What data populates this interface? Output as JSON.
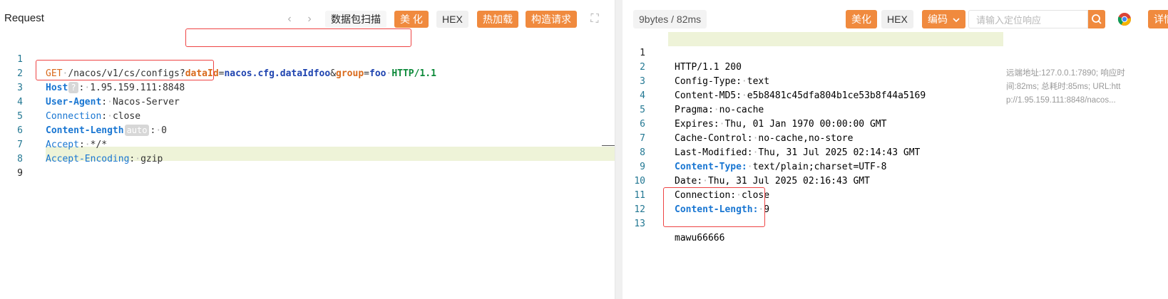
{
  "request": {
    "title": "Request",
    "toolbar": {
      "packet_scan": "数据包扫描",
      "beautify": "美 化",
      "hex": "HEX",
      "hot_load": "热加载",
      "build_request": "构造请求"
    },
    "lines": [
      {
        "n": "1"
      },
      {
        "n": "2"
      },
      {
        "n": "3"
      },
      {
        "n": "4"
      },
      {
        "n": "5"
      },
      {
        "n": "6"
      },
      {
        "n": "7"
      },
      {
        "n": "8"
      },
      {
        "n": "9"
      }
    ],
    "request_line": {
      "method": "GET",
      "path": "/nacos/v1/cs/configs",
      "q": "?",
      "k1": "dataId",
      "eq1": "=",
      "v1": "nacos.cfg.dataIdfoo",
      "amp": "&",
      "k2": "group",
      "eq2": "=",
      "v2": "foo",
      "protocol": "HTTP/1.1"
    },
    "headers": {
      "host": {
        "name": "Host",
        "badge": "?",
        "value": "1.95.159.111:8848"
      },
      "user_agent": {
        "name": "User-Agent",
        "value": "Nacos-Server"
      },
      "connection": {
        "name": "Connection",
        "value": "close"
      },
      "content_length": {
        "name": "Content-Length",
        "badge": "auto",
        "value": "0"
      },
      "accept": {
        "name": "Accept",
        "value": "*/*"
      },
      "accept_encoding": {
        "name": "Accept-Encoding",
        "value": "gzip"
      }
    }
  },
  "response": {
    "size_info": "9bytes / 82ms",
    "toolbar": {
      "beautify": "美化",
      "hex": "HEX",
      "encoding": "编码",
      "search_placeholder": "请输入定位响应",
      "details": "详情"
    },
    "lines": [
      {
        "n": "1"
      },
      {
        "n": "2"
      },
      {
        "n": "3"
      },
      {
        "n": "4"
      },
      {
        "n": "5"
      },
      {
        "n": "6"
      },
      {
        "n": "7"
      },
      {
        "n": "8"
      },
      {
        "n": "9"
      },
      {
        "n": "10"
      },
      {
        "n": "11"
      },
      {
        "n": "12"
      },
      {
        "n": "13"
      }
    ],
    "status_line": "HTTP/1.1 200",
    "headers": [
      {
        "name": "Config-Type",
        "value": "text"
      },
      {
        "name": "Content-MD5",
        "value": "e5b8481c45dfa804b1ce53b8f44a5169"
      },
      {
        "name": "Pragma",
        "value": "no-cache"
      },
      {
        "name": "Expires",
        "value": "Thu, 01 Jan 1970 00:00:00 GMT"
      },
      {
        "name": "Cache-Control",
        "value": "no-cache,no-store"
      },
      {
        "name": "Last-Modified",
        "value": "Thu, 31 Jul 2025 02:14:43 GMT"
      },
      {
        "name": "Content-Type:",
        "value": "text/plain;charset=UTF-8"
      },
      {
        "name": "Date",
        "value": "Thu, 31 Jul 2025 02:16:43 GMT"
      },
      {
        "name": "Connection",
        "value": "close"
      },
      {
        "name": "Content-Length:",
        "value": "9"
      }
    ],
    "body": "mawu66666",
    "side_info": "远端地址:127.0.0.1:7890; 响应时间:82ms; 总耗时:85ms; URL:http://1.95.159.111:8848/nacos..."
  },
  "colors": {
    "accent": "#f08a3e",
    "highlight_line": "#eef3d8",
    "annotation_red": "#e44444"
  },
  "icons": [
    "chevron-left-icon",
    "chevron-right-icon",
    "expand-icon",
    "search-icon",
    "chrome-icon",
    "chevron-down-icon"
  ]
}
